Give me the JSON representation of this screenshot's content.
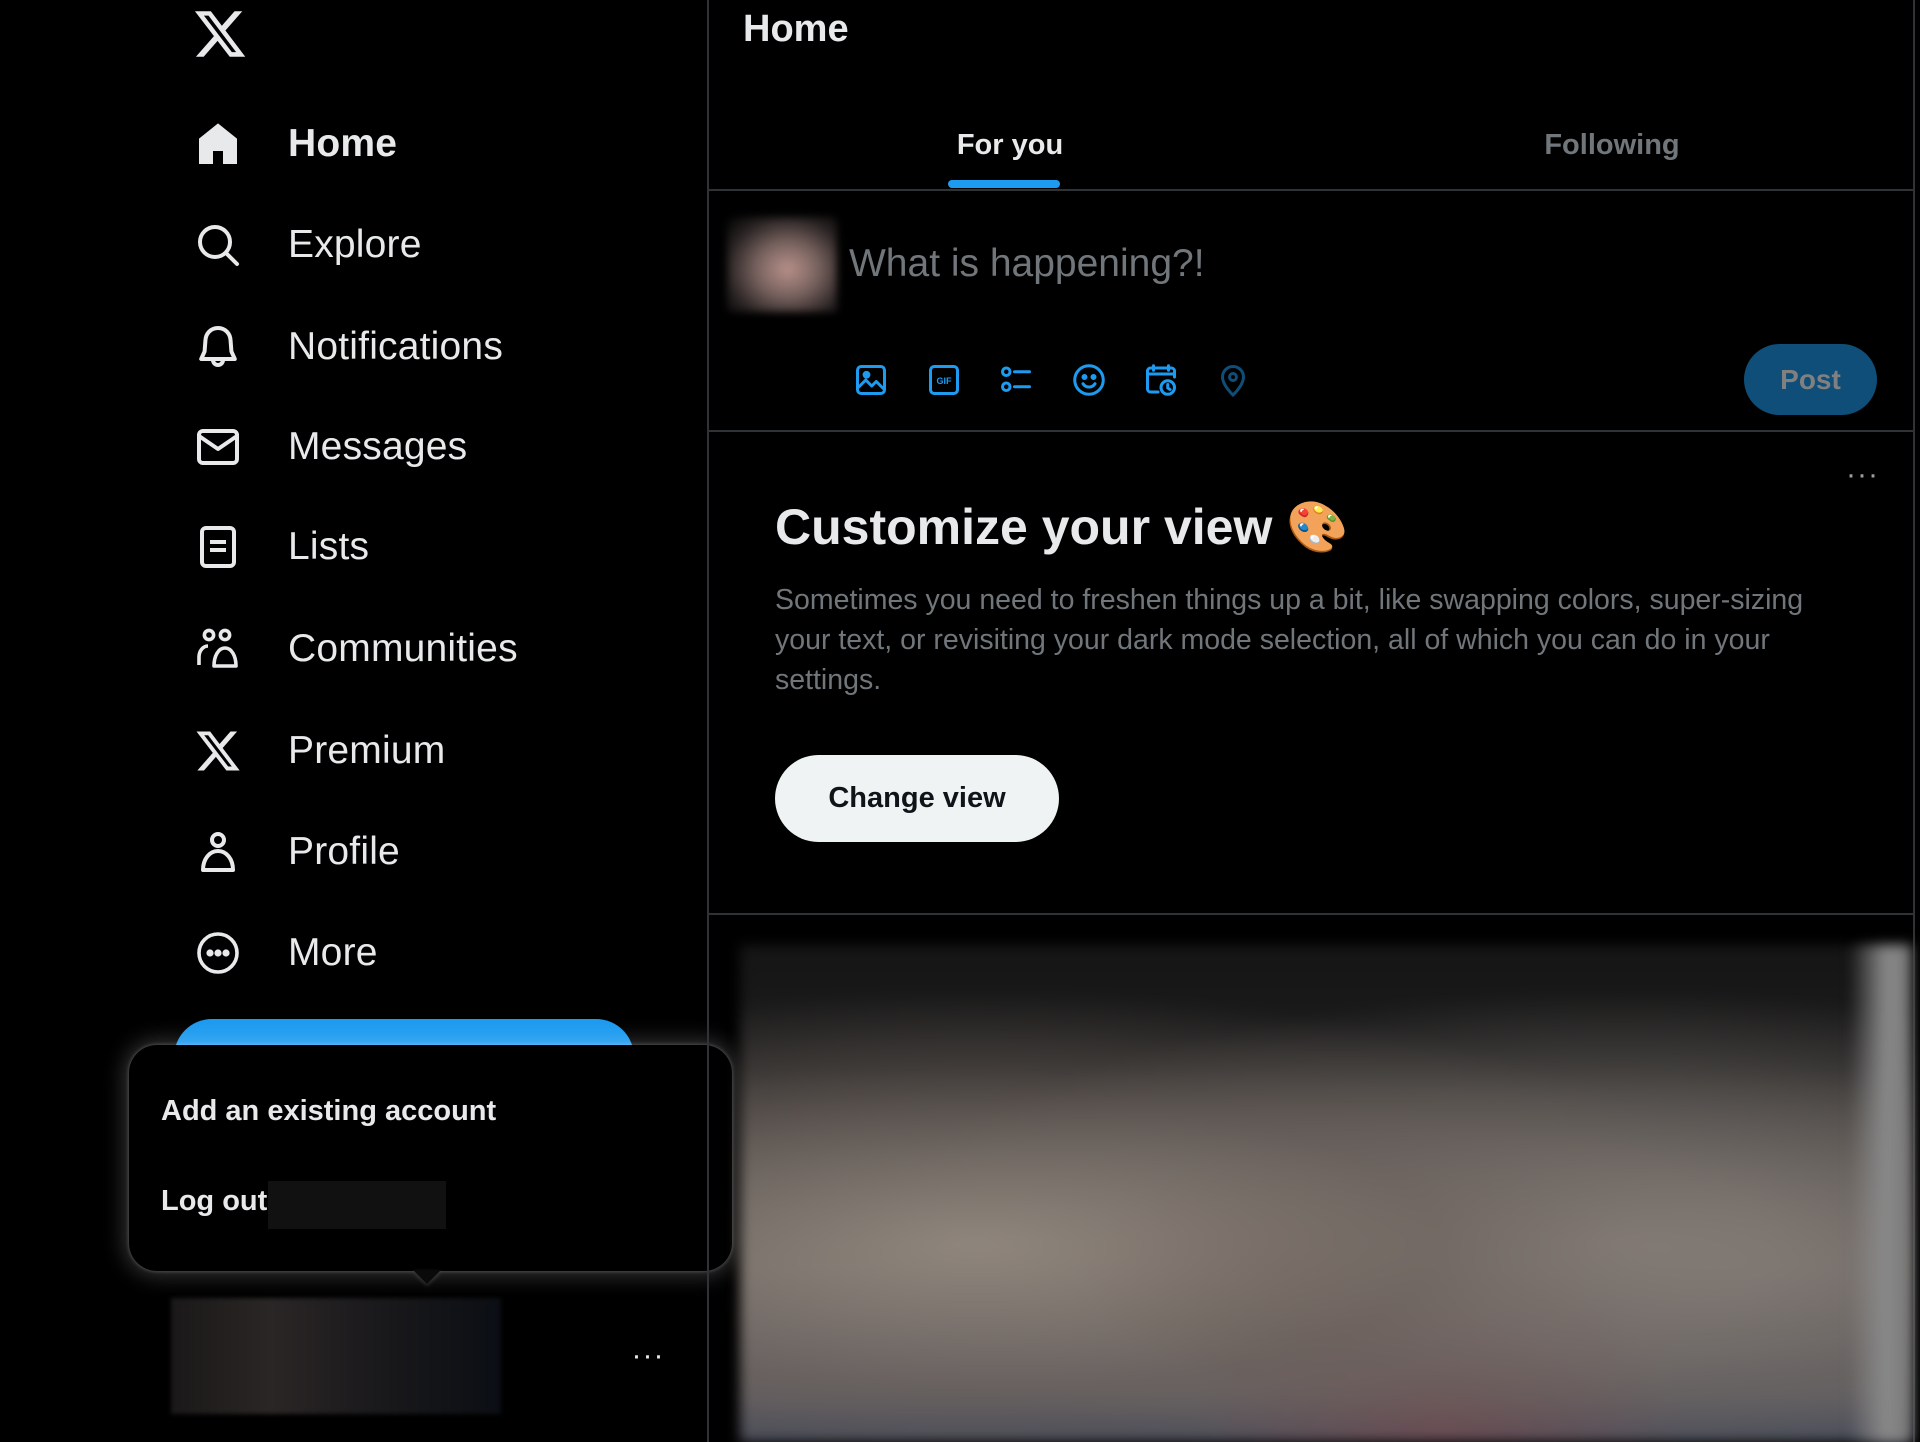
{
  "app": {
    "logo": "X"
  },
  "sidebar": {
    "items": [
      {
        "label": "Home",
        "icon": "home-icon",
        "active": true
      },
      {
        "label": "Explore",
        "icon": "search-icon"
      },
      {
        "label": "Notifications",
        "icon": "bell-icon"
      },
      {
        "label": "Messages",
        "icon": "envelope-icon"
      },
      {
        "label": "Lists",
        "icon": "list-icon"
      },
      {
        "label": "Communities",
        "icon": "communities-icon"
      },
      {
        "label": "Premium",
        "icon": "x-logo-icon"
      },
      {
        "label": "Profile",
        "icon": "person-icon"
      },
      {
        "label": "More",
        "icon": "more-circle-icon"
      }
    ],
    "account_menu": {
      "add_account": "Add an existing account",
      "log_out": "Log out"
    },
    "account_more": "···"
  },
  "header": {
    "title": "Home",
    "tabs": [
      {
        "label": "For you",
        "active": true
      },
      {
        "label": "Following",
        "active": false
      }
    ]
  },
  "composer": {
    "placeholder": "What is happening?!",
    "value": "",
    "tools": [
      {
        "name": "media-icon"
      },
      {
        "name": "gif-icon"
      },
      {
        "name": "poll-icon"
      },
      {
        "name": "emoji-icon"
      },
      {
        "name": "schedule-icon"
      },
      {
        "name": "location-icon",
        "disabled": true
      }
    ],
    "post_label": "Post"
  },
  "card": {
    "more": "···",
    "title": "Customize your view 🎨",
    "body": "Sometimes you need to freshen things up a bit, like swapping colors, super-sizing your text, or revisiting your dark mode selection, all of which you can do in your settings.",
    "button": "Change view"
  },
  "colors": {
    "accent": "#1d9bf0",
    "background": "#000000",
    "text_primary": "#e7e9ea",
    "text_secondary": "#71767b",
    "border": "#2f3336"
  }
}
